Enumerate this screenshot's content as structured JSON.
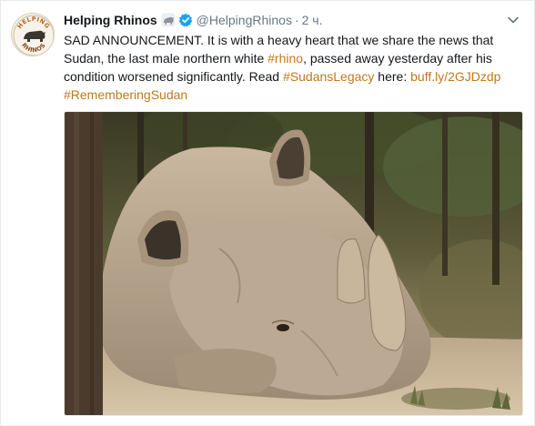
{
  "tweet": {
    "author_name": "Helping Rhinos",
    "handle": "@HelpingRhinos",
    "separator": "·",
    "time": "2 ч.",
    "avatar_logo_text": "HELPING RHINOS",
    "text_lines": [
      [
        {
          "text": "SAD ANNOUNCEMENT. It is with a heavy heart that we share the news that",
          "link": false
        }
      ],
      [
        {
          "text": "Sudan, the last male northern white ",
          "link": false
        },
        {
          "text": "#rhino",
          "link": true
        },
        {
          "text": ", passed away yesterday after his",
          "link": false
        }
      ],
      [
        {
          "text": "condition worsened significantly. Read ",
          "link": false
        },
        {
          "text": "#SudansLegacy",
          "link": true
        },
        {
          "text": " here: ",
          "link": false
        },
        {
          "text": "buff.ly/2GJDzdp",
          "link": true
        }
      ],
      [
        {
          "text": "#RememberingSudan",
          "link": true
        }
      ]
    ],
    "colors": {
      "link": "#c0791d",
      "muted": "#657786",
      "verified": "#1da1f2"
    },
    "icons": {
      "verified": "verified-badge-icon",
      "emoji": "rhino-emoji-icon",
      "menu": "chevron-down-icon"
    },
    "media": {
      "description_icon": "photo"
    }
  }
}
